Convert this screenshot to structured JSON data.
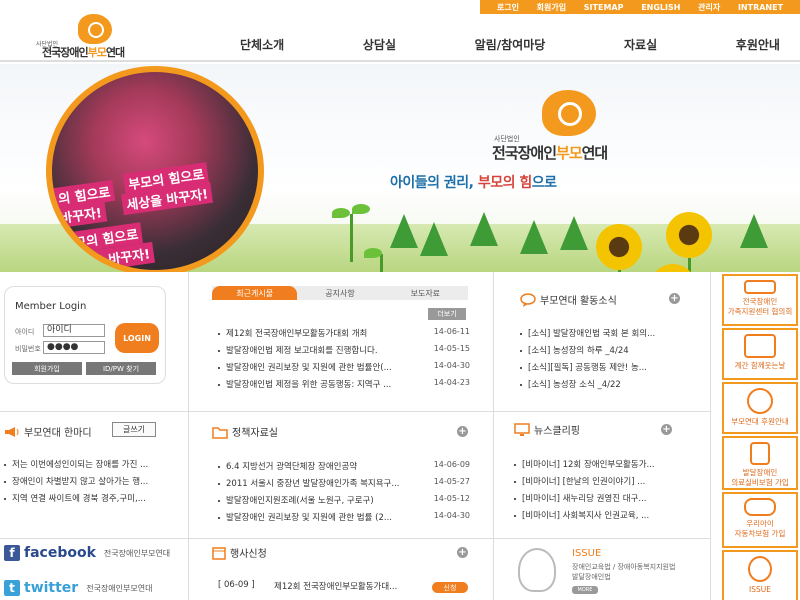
{
  "util_menu": [
    "로그인",
    "회원가입",
    "SITEMAP",
    "ENGLISH",
    "관리자",
    "INTRANET"
  ],
  "brand": {
    "small": "사단법인",
    "name_a": "전국장애인",
    "name_b": "부모",
    "name_c": "연대"
  },
  "gnb": [
    "단체소개",
    "상담실",
    "알림/참여마당",
    "자료실",
    "후원안내"
  ],
  "hero": {
    "photo_texts": [
      "부모의 힘으로",
      "세상을 바꾸자!",
      "의 힘으로",
      "바꾸자!",
      "부모의 힘으로",
      "세상을 바꾸자!"
    ],
    "small": "사단법인",
    "name_a": "전국장애인",
    "name_b": "부모",
    "name_c": "연대",
    "slogan_a": "아이들의 권리, ",
    "slogan_b": "부모의 힘",
    "slogan_c": "으로"
  },
  "login": {
    "title": "Member Login",
    "id_label": "아이디",
    "id_value": "아이디",
    "pw_label": "비밀번호",
    "pw_value": "●●●●",
    "button": "LOGIN",
    "join": "회원가입",
    "find": "ID/PW 찾기"
  },
  "board": {
    "tabs": [
      "최근게시물",
      "공지사항",
      "보도자료"
    ],
    "more": "더보기",
    "items": [
      {
        "title": "제12회 전국장애인부모활동가대회 개최",
        "date": "14-06-11"
      },
      {
        "title": "발달장애인법 제정 보고대회를 진행합니다.",
        "date": "14-05-15"
      },
      {
        "title": "발달장애인 권리보장 및 지원에 관한 법률안(...",
        "date": "14-04-30"
      },
      {
        "title": "발달장애인법 제정을 위한 공동행동: 지역구 ...",
        "date": "14-04-23"
      }
    ]
  },
  "activity": {
    "title": "부모연대 활동소식",
    "items": [
      "[소식] 발달장애인법 국회 본 회의...",
      "[소식] 농성장의 하루 _4/24",
      "[소식][필독] 공동행동 제안! 농...",
      "[소식] 농성장 소식 _4/22"
    ]
  },
  "oneword": {
    "title": "부모연대 한마디",
    "write": "글쓰기",
    "items": [
      "저는 이번에성인이되는 장애를 가진 ...",
      "장애인이 차별받지 않고 살아가는 행...",
      "지역 연결 싸이트에 경북 경주,구미,..."
    ]
  },
  "policy": {
    "title": "정책자료실",
    "items": [
      {
        "title": "6.4 지방선거 광역단체장 장애인공약",
        "date": "14-06-09"
      },
      {
        "title": "2011 서울시 중장년 발달장애인가족 복지욕구...",
        "date": "14-05-27"
      },
      {
        "title": "발달장애인지원조례(서울 노원구, 구로구)",
        "date": "14-05-12"
      },
      {
        "title": "발달장애인 권리보장 및 지원에 관한 법률 (2...",
        "date": "14-04-30"
      }
    ]
  },
  "news": {
    "title": "뉴스클리핑",
    "items": [
      "[비마이너] 12회 장애인부모활동가...",
      "[비마이너] [한날의 인권이야기] ...",
      "[비마이너] 새누리당 권영진 대구...",
      "[비마이너] 사회복지사 인권교육, ..."
    ]
  },
  "sns": {
    "facebook": "facebook",
    "twitter": "twitter",
    "sub": "전국장애인부모연대"
  },
  "event": {
    "title": "행사신청",
    "date": "[ 06-09 ]",
    "item": "제12회 전국장애인부모활동가대...",
    "apply": "신청"
  },
  "issue": {
    "title": "ISSUE",
    "line1": "장애인교육법 / 장애아동복지지원법",
    "line2": "발달장애인법",
    "more": "MORE"
  },
  "quick": [
    "전국장애인\n가족지원센터 협의회",
    "계간 함께웃는날",
    "부모연대 후원안내",
    "발달장애인\n의료실비보험 가입",
    "우리아이\n자동차보험 가입",
    "ISSUE"
  ],
  "colors": {
    "accent": "#f39a1e",
    "button": "#f07d1e",
    "slogan_blue": "#1c6fa8",
    "slogan_red": "#d6453d"
  }
}
